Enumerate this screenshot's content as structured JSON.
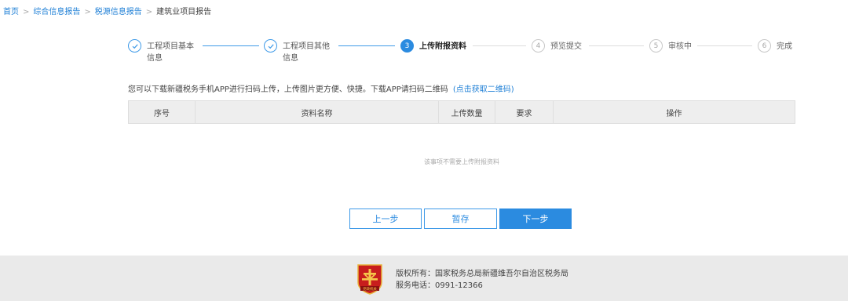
{
  "breadcrumb": {
    "home": "首页",
    "level1": "综合信息报告",
    "level2": "税源信息报告",
    "current": "建筑业项目报告",
    "separator": ">"
  },
  "steps": [
    {
      "number": "1",
      "line1": "工程项目基本",
      "line2": "信息",
      "status": "done"
    },
    {
      "number": "2",
      "line1": "工程项目其他",
      "line2": "信息",
      "status": "done"
    },
    {
      "number": "3",
      "line1": "上传附报资料",
      "line2": "",
      "status": "active"
    },
    {
      "number": "4",
      "line1": "预览提交",
      "line2": "",
      "status": "todo"
    },
    {
      "number": "5",
      "line1": "审核中",
      "line2": "",
      "status": "todo"
    },
    {
      "number": "6",
      "line1": "完成",
      "line2": "",
      "status": "todo"
    }
  ],
  "icons": {
    "done_step": "check-icon"
  },
  "notice": {
    "text": "您可以下载新疆税务手机APP进行扫码上传，上传图片更方便、快捷。下载APP请扫码二维码",
    "link_open": "(",
    "link_text": "点击获取二维码",
    "link_close": ")"
  },
  "table": {
    "columns": [
      "序号",
      "资料名称",
      "上传数量",
      "要求",
      "操作"
    ],
    "empty_text": "该事项不需要上传附报资料"
  },
  "buttons": {
    "prev": "上一步",
    "save": "暂存",
    "next": "下一步"
  },
  "footer": {
    "copyright": "版权所有：国家税务总局新疆维吾尔自治区税务局",
    "phone": "服务电话：0991-12366",
    "badge_text": "党政机关"
  },
  "colors": {
    "accent": "#2b8be0",
    "link": "#1e7fd6",
    "header_bg": "#eeeeee",
    "footer_bg": "#eaeaea",
    "badge_red": "#c81d1d",
    "badge_gold": "#e8b23a"
  }
}
